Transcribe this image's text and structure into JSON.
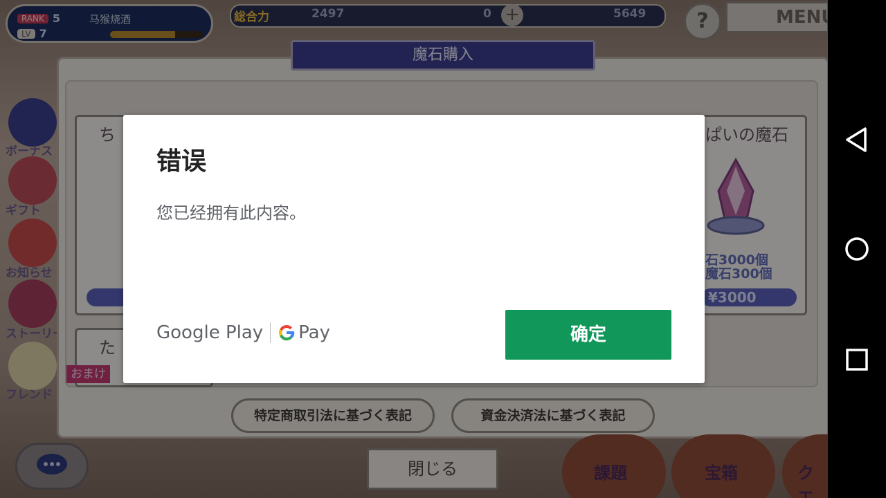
{
  "game": {
    "status": {
      "rank_label": "RANK",
      "rank_value": "5",
      "lv_label": "LV",
      "lv_value": "7",
      "player_name": "马猴烧酒",
      "exp_progress": 0.7
    },
    "topbar": {
      "total_power_label": "総合力",
      "total_power_value": "2497",
      "currency1_value": "0",
      "currency2_value": "5649",
      "help_symbol": "?",
      "menu_label": "MENU"
    },
    "side_menu": [
      "ボーナス",
      "ギフト",
      "お知らせ",
      "ストーリー",
      "フレンド"
    ],
    "bottom_menu": [
      "課題",
      "宝箱",
      "クエ"
    ],
    "purchase_panel": {
      "title": "魔石購入",
      "card_left_title": "ち",
      "card_right_title": "ぱいの魔石",
      "card_right_line1": "石3000個",
      "card_right_line2": "魔石300個",
      "card_right_price": "¥3000",
      "card_left2_title": "た",
      "omake_label": "おまけ",
      "law_button_1": "特定商取引法に基づく表記",
      "law_button_2": "資金決済法に基づく表記",
      "close_button": "閉じる"
    }
  },
  "dialog": {
    "title": "错误",
    "message": "您已经拥有此内容。",
    "brand_play": "Google Play",
    "brand_pay": "Pay",
    "confirm_button": "确定",
    "colors": {
      "button": "#11975a",
      "text": "#5f6368"
    }
  },
  "android_nav": {
    "icons": [
      "back-icon",
      "home-icon",
      "recents-icon"
    ]
  }
}
